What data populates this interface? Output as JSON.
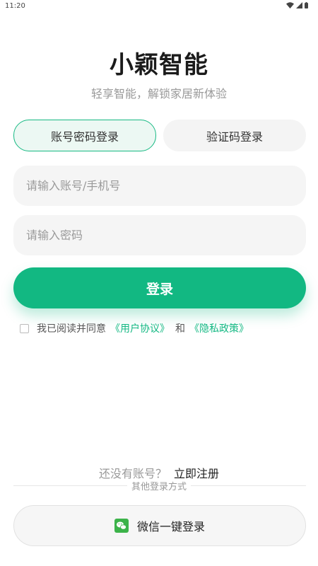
{
  "status_bar": {
    "time": "11:20"
  },
  "header": {
    "title": "小颖智能",
    "subtitle": "轻享智能，解锁家居新体验"
  },
  "tabs": [
    {
      "label": "账号密码登录",
      "active": true
    },
    {
      "label": "验证码登录",
      "active": false
    }
  ],
  "form": {
    "account_placeholder": "请输入账号/手机号",
    "account_value": "",
    "password_placeholder": "请输入密码",
    "password_value": ""
  },
  "login_button": {
    "label": "登录"
  },
  "agreement": {
    "prefix": "我已阅读并同意",
    "terms": "《用户协议》",
    "and": "和",
    "privacy": "《隐私政策》",
    "checked": false
  },
  "register": {
    "prompt": "还没有账号？",
    "link": "立即注册"
  },
  "other_login": {
    "divider_label": "其他登录方式",
    "wechat_label": "微信一键登录"
  },
  "colors": {
    "accent": "#12b882",
    "field_bg": "#f5f5f5",
    "muted_text": "#999999"
  },
  "icons": [
    "wifi-icon",
    "signal-icon",
    "battery-icon",
    "wechat-icon"
  ]
}
